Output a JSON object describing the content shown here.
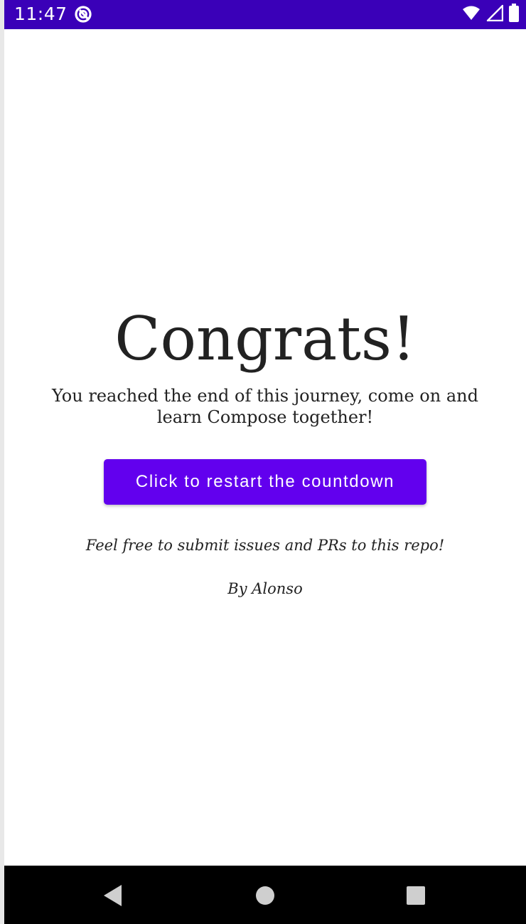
{
  "status_bar": {
    "time": "11:47",
    "background_color": "#3a00b8",
    "icons": [
      "app-notification-icon",
      "wifi-icon",
      "cell-signal-icon",
      "battery-icon"
    ]
  },
  "main": {
    "title": "Congrats!",
    "message": "You reached the end of this journey, come on and learn Compose together!",
    "restart_button_label": "Click to restart the countdown",
    "note": "Feel free to submit issues and PRs to this repo!",
    "author": "By Alonso"
  },
  "colors": {
    "accent": "#6200ee",
    "text": "#222222"
  },
  "nav_bar": {
    "icons": [
      "back-icon",
      "home-icon",
      "recents-icon"
    ]
  }
}
